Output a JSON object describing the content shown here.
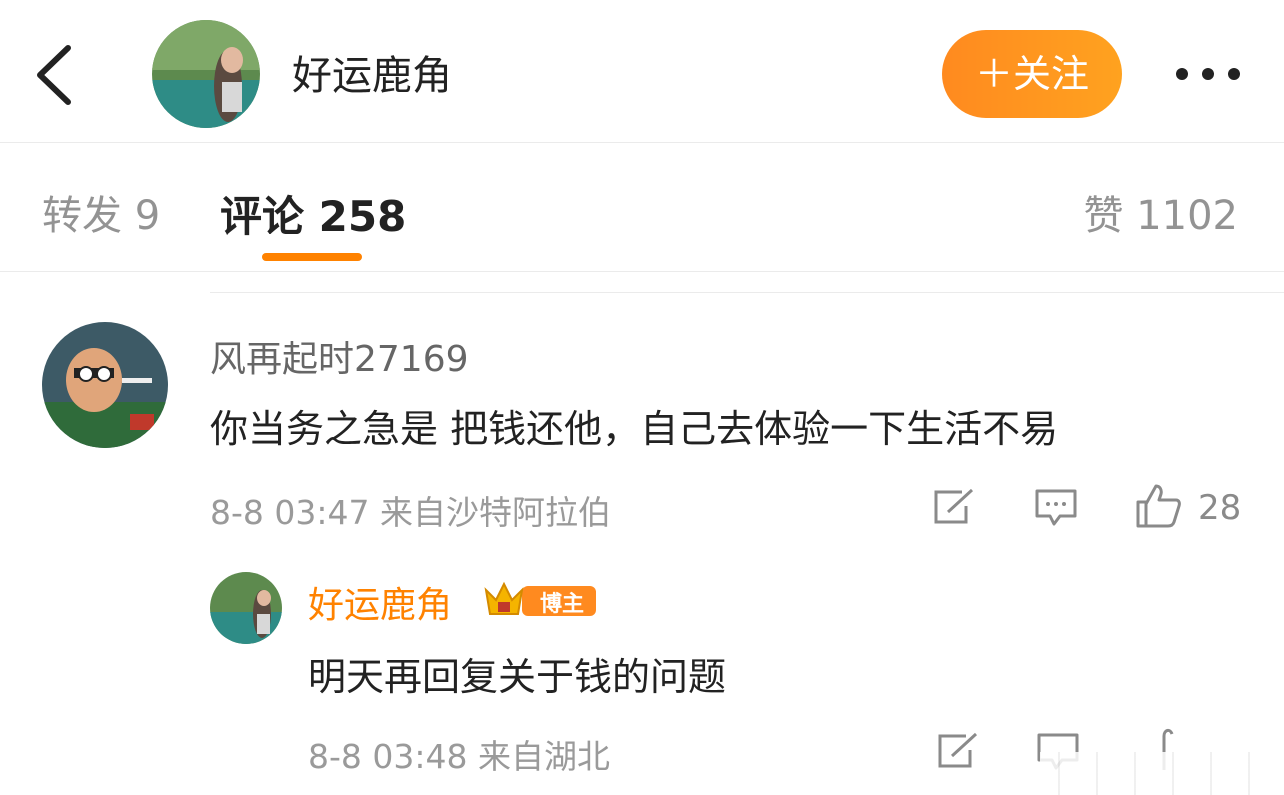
{
  "header": {
    "title": "好运鹿角",
    "follow_label": "＋关注"
  },
  "tabs": {
    "reposts": "转发 9",
    "comments": "评论 258",
    "likes": "赞 1102"
  },
  "comment": {
    "user": "风再起时27169",
    "text": "你当务之急是 把钱还他，自己去体验一下生活不易",
    "meta": "8-8 03:47 来自沙特阿拉伯",
    "like_count": "28"
  },
  "reply": {
    "user": "好运鹿角",
    "badge": "博主",
    "text": "明天再回复关于钱的问题",
    "meta": "8-8 03:48 来自湖北"
  },
  "colors": {
    "accent": "#ff8200",
    "follow_gradient_start": "#ff8a1f",
    "follow_gradient_end": "#ffa21f",
    "muted_text": "#9a9a9a"
  },
  "icons": [
    "back-icon",
    "more-icon",
    "repost-icon",
    "comment-icon",
    "like-icon",
    "crown-icon"
  ]
}
